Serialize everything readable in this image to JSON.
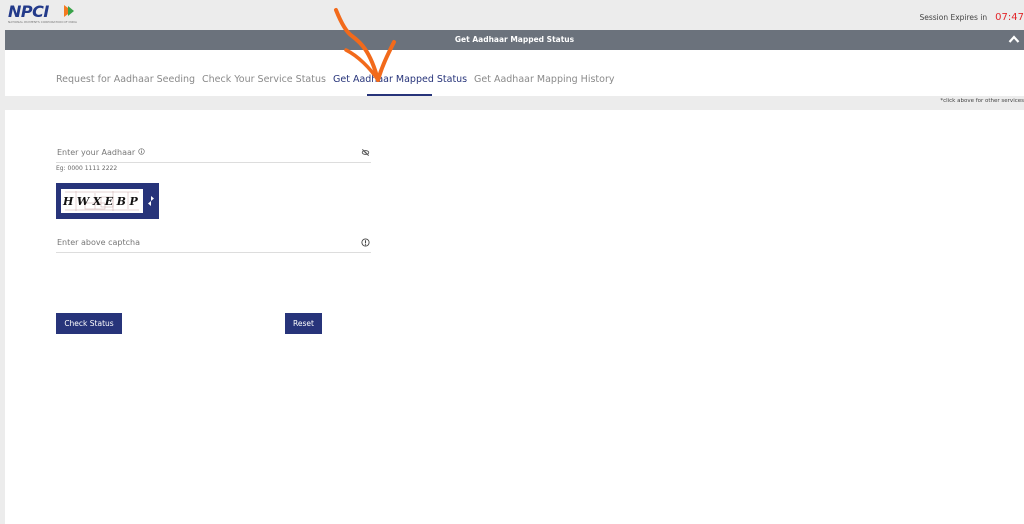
{
  "header": {
    "logo_text": "NPCI",
    "logo_subtitle": "NATIONAL PAYMENTS CORPORATION OF INDIA",
    "session_label": "Session Expires in",
    "session_timer": "07:47"
  },
  "panel": {
    "title": "Get Aadhaar Mapped Status",
    "collapse_icon": "chevron-up-icon"
  },
  "tabs": [
    {
      "label": "Request for Aadhaar Seeding",
      "active": false
    },
    {
      "label": "Check Your Service Status",
      "active": false
    },
    {
      "label": "Get Aadhaar Mapped Status",
      "active": true
    },
    {
      "label": "Get Aadhaar Mapping History",
      "active": false
    }
  ],
  "hint": "*click above for other services",
  "form": {
    "aadhaar_label": "Enter your Aadhaar",
    "aadhaar_info_icon": "info-icon",
    "aadhaar_toggle_icon": "eye-slash-icon",
    "aadhaar_example": "Eg: 0000 1111 2222",
    "captcha_text": "HWXEBP",
    "captcha_refresh_icon": "refresh-icon",
    "captcha_label": "Enter above captcha",
    "captcha_info_icon": "info-icon"
  },
  "buttons": {
    "check_status": "Check Status",
    "reset": "Reset"
  },
  "colors": {
    "primary": "#27347a",
    "panel_header": "#6b727c",
    "timer": "#e3262a",
    "annotation": "#f26a1b"
  }
}
